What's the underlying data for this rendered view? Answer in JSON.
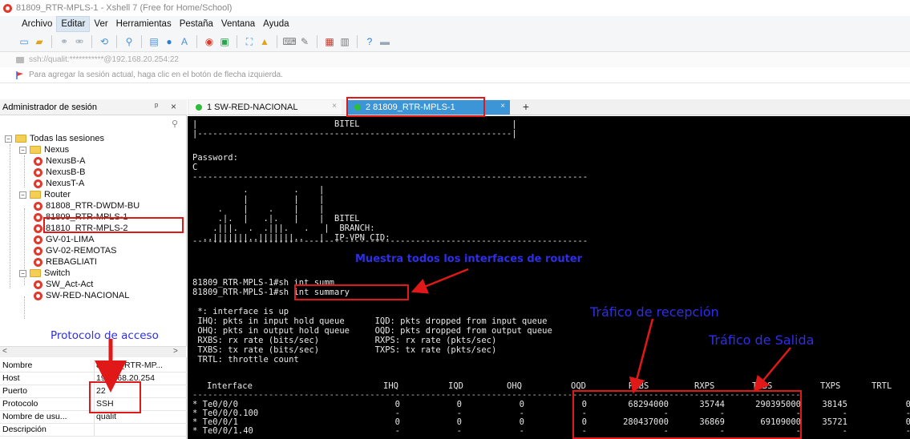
{
  "window": {
    "title": "81809_RTR-MPLS-1 - Xshell 7 (Free for Home/School)"
  },
  "menu": [
    "Archivo",
    "Editar",
    "Ver",
    "Herramientas",
    "Pestaña",
    "Ventana",
    "Ayuda"
  ],
  "address": "ssh://qualit:***********@192.168.20.254:22",
  "info_bar": "Para agregar la sesión actual, haga clic en el botón de flecha izquierda.",
  "session_manager": {
    "title": "Administrador de sesión",
    "pin": "ᵖ",
    "close": "×",
    "tree": {
      "root": "Todas las sesiones",
      "folders": [
        {
          "name": "Nexus",
          "items": [
            "NexusB-A",
            "NexusB-B",
            "NexusT-A"
          ]
        },
        {
          "name": "Router",
          "items": [
            "81808_RTR-DWDM-BU",
            "81809_RTR-MPLS-1",
            "81810_RTR-MPLS-2",
            "GV-01-LIMA",
            "GV-02-REMOTAS",
            "REBAGLIATI"
          ]
        },
        {
          "name": "Switch",
          "items": [
            "SW_Act-Act",
            "SW-RED-NACIONAL"
          ]
        }
      ]
    },
    "properties": [
      {
        "key": "Nombre",
        "value": "81809_RTR-MP..."
      },
      {
        "key": "Host",
        "value": "192.168.20.254"
      },
      {
        "key": "Puerto",
        "value": "22"
      },
      {
        "key": "Protocolo",
        "value": "SSH"
      },
      {
        "key": "Nombre de usu...",
        "value": "qualit"
      },
      {
        "key": "Descripción",
        "value": ""
      }
    ]
  },
  "tabs": [
    {
      "label": "1 SW-RED-NACIONAL",
      "close": "×"
    },
    {
      "label": "2 81809_RTR-MPLS-1",
      "close": "×"
    }
  ],
  "tab_add": "+",
  "terminal": {
    "banner_title": "BITEL",
    "banner_line_1": "|                           BITEL                              |",
    "banner_line_2": "|--------------------------------------------------------------|",
    "password": "Password:",
    "c_line": "C",
    "dash_line": "------------------------------------------------------------------------------",
    "logo_lines": [
      "          .         .    |",
      "          |         |    |",
      "     .    |    .    |    |",
      "     .|.  |   .|.   |    |  BITEL",
      "    .|||.  .  .|||.   .   |  BRANCH:",
      "  ..|||||||..|||||||..   |  IP-VPN CID:"
    ],
    "dash_line_2": "------------------------------------------------------------------------------",
    "cmd_1": "81809_RTR-MPLS-1#sh int summ",
    "cmd_2": "81809_RTR-MPLS-1#sh int summary",
    "legend": [
      " *: interface is up",
      " IHQ: pkts in input hold queue      IQD: pkts dropped from input queue",
      " OHQ: pkts in output hold queue     OQD: pkts dropped from output queue",
      " RXBS: rx rate (bits/sec)           RXPS: rx rate (pkts/sec)",
      " TXBS: tx rate (bits/sec)           TXPS: tx rate (pkts/sec)",
      " TRTL: throttle count"
    ],
    "columns": [
      "Interface",
      "IHQ",
      "IQD",
      "OHQ",
      "OQD",
      "RXBS",
      "RXPS",
      "TXBS",
      "TXPS",
      "TRTL"
    ],
    "rows": [
      {
        "iface": "* Te0/0/0",
        "ihq": "0",
        "iqd": "0",
        "ohq": "0",
        "oqd": "0",
        "rxbs": "68294000",
        "rxps": "35744",
        "txbs": "290395000",
        "txps": "38145",
        "trtl": "0"
      },
      {
        "iface": "* Te0/0/0.100",
        "ihq": "-",
        "iqd": "-",
        "ohq": "-",
        "oqd": "-",
        "rxbs": "-",
        "rxps": "-",
        "txbs": "-",
        "txps": "-",
        "trtl": "-"
      },
      {
        "iface": "* Te0/0/1",
        "ihq": "0",
        "iqd": "0",
        "ohq": "0",
        "oqd": "0",
        "rxbs": "280437000",
        "rxps": "36869",
        "txbs": "69109000",
        "txps": "35721",
        "trtl": "0"
      },
      {
        "iface": "* Te0/0/1.40",
        "ihq": "-",
        "iqd": "-",
        "ohq": "-",
        "oqd": "-",
        "rxbs": "-",
        "rxps": "-",
        "txbs": "-",
        "txps": "-",
        "trtl": "-"
      }
    ]
  },
  "annotations": {
    "interfaces_note": "Muestra todos los interfaces de router",
    "access_protocol": "Protocolo de acceso",
    "rx_traffic": "Tráfico de recepción",
    "tx_traffic": "Tráfico de Salida"
  },
  "colors": {
    "annotation_red": "#e01818",
    "annotation_blue": "#2e2ee8",
    "terminal_bg": "#000000",
    "active_tab": "#3c95d6"
  }
}
